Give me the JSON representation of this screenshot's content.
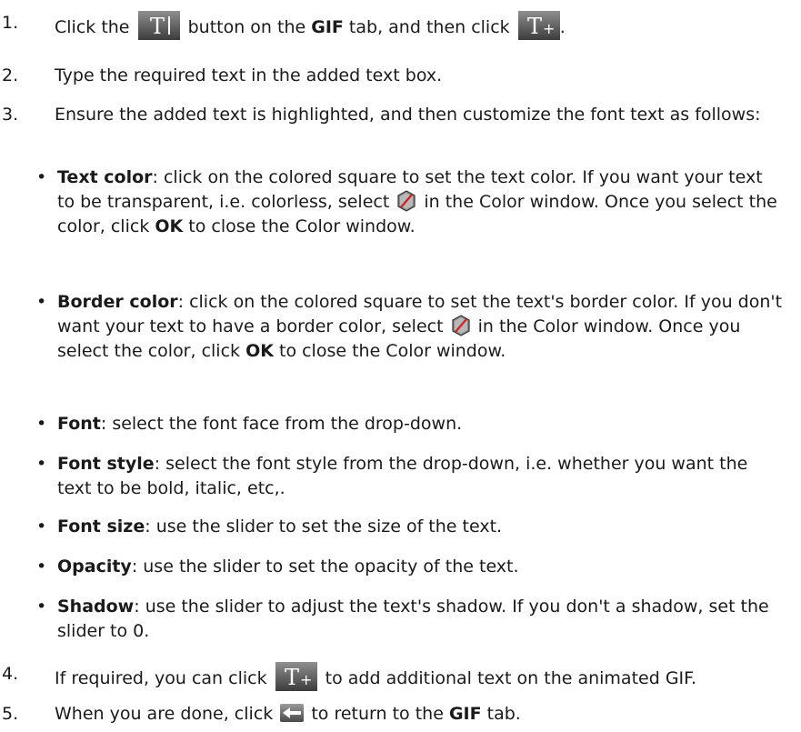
{
  "steps": [
    {
      "num": "1.",
      "parts": [
        "Click the ",
        {
          "icon": "text-tool-icon"
        },
        " button on the ",
        {
          "bold": "GIF"
        },
        " tab, and then click ",
        {
          "icon": "add-text-icon"
        },
        "."
      ]
    },
    {
      "num": "2.",
      "parts": [
        "Type the required text in the added text box."
      ]
    },
    {
      "num": "3.",
      "parts": [
        "Ensure the added text is highlighted, and then customize the font text as follows:"
      ]
    },
    {
      "num": "4.",
      "parts": [
        "If required, you can click ",
        {
          "icon": "add-text-icon"
        },
        " to add additional text on the animated GIF."
      ]
    },
    {
      "num": "5.",
      "parts": [
        "When you are done, click ",
        {
          "icon": "back-arrow-icon"
        },
        " to return to the ",
        {
          "bold": "GIF"
        },
        " tab."
      ]
    }
  ],
  "bullets": [
    {
      "parts": [
        {
          "bold": "Text color"
        },
        ": click on the colored square to set the text color. If you want your text to be transparent, i.e. colorless, select ",
        {
          "icon": "no-color-icon"
        },
        " in the Color window. Once you select the color, click ",
        {
          "bold": "OK"
        },
        " to close the Color window."
      ]
    },
    {
      "parts": [
        {
          "bold": "Border color"
        },
        ": click on the colored square to set the text's border color. If you don't want your text to have a border color, select ",
        {
          "icon": "no-color-icon"
        },
        " in the Color window. Once you select the color, click ",
        {
          "bold": "OK"
        },
        " to close the Color window."
      ]
    },
    {
      "parts": [
        {
          "bold": "Font"
        },
        ": select the font face from the drop-down."
      ]
    },
    {
      "parts": [
        {
          "bold": "Font style"
        },
        ": select the font style from the drop-down, i.e. whether you want the text to be bold, italic, etc,."
      ]
    },
    {
      "parts": [
        {
          "bold": "Font size"
        },
        ": use the slider to set the size of the text."
      ]
    },
    {
      "parts": [
        {
          "bold": "Opacity"
        },
        ": use the slider to set the opacity of the text."
      ]
    },
    {
      "parts": [
        {
          "bold": "Shadow"
        },
        ": use the slider to adjust the text's shadow. If you don't a shadow, set the slider to 0."
      ]
    }
  ],
  "bullet_char": "•"
}
